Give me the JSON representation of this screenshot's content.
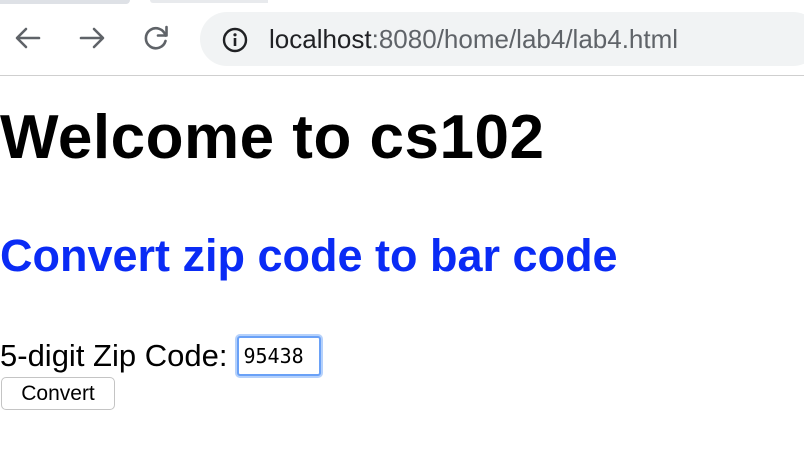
{
  "browser": {
    "url_host": "localhost",
    "url_rest": ":8080/home/lab4/lab4.html",
    "icons": {
      "back": "back-arrow-icon",
      "forward": "forward-arrow-icon",
      "reload": "reload-icon",
      "site_info": "info-icon"
    }
  },
  "page": {
    "title": "Welcome to cs102",
    "subtitle": "Convert zip code to bar code",
    "zip_label": "5-digit Zip Code:",
    "zip_value": "95438",
    "convert_button": "Convert"
  },
  "colors": {
    "subtitle": "#0a2bf5",
    "focus_ring": "#6aa1f7"
  }
}
